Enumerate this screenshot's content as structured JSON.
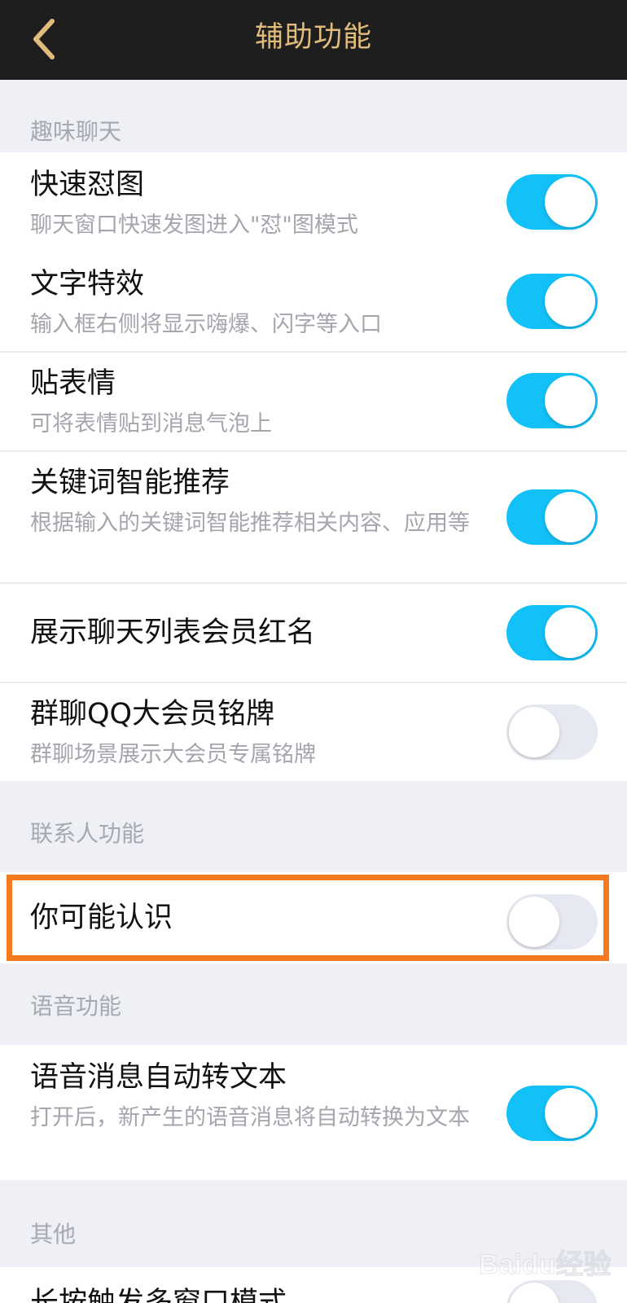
{
  "navbar": {
    "title": "辅助功能",
    "back_icon": "chevron-left-icon"
  },
  "colors": {
    "accent": "#12c1f8",
    "nav_bg": "#1f1e1f",
    "nav_title": "#e1bc7b",
    "highlight": "#f5791f"
  },
  "sections": {
    "fun_chat": {
      "header": "趣味聊天",
      "items": [
        {
          "title": "快速怼图",
          "subtitle": "聊天窗口快速发图进入\"怼\"图模式",
          "enabled": true
        },
        {
          "title": "文字特效",
          "subtitle": "输入框右侧将显示嗨爆、闪字等入口",
          "enabled": true
        },
        {
          "title": "贴表情",
          "subtitle": "可将表情贴到消息气泡上",
          "enabled": true
        },
        {
          "title": "关键词智能推荐",
          "subtitle": "根据输入的关键词智能推荐相关内容、应用等",
          "enabled": true
        },
        {
          "title": "展示聊天列表会员红名",
          "subtitle": "",
          "enabled": true
        },
        {
          "title": "群聊QQ大会员铭牌",
          "subtitle": "群聊场景展示大会员专属铭牌",
          "enabled": false
        }
      ]
    },
    "contacts": {
      "header": "联系人功能",
      "items": [
        {
          "title": "你可能认识",
          "subtitle": "",
          "enabled": false
        }
      ]
    },
    "voice": {
      "header": "语音功能",
      "items": [
        {
          "title": "语音消息自动转文本",
          "subtitle": "打开后，新产生的语音消息将自动转换为文本",
          "enabled": true
        }
      ]
    },
    "other": {
      "header": "其他",
      "items": [
        {
          "title": "长按触发多窗口模式",
          "subtitle": "",
          "enabled": false
        }
      ]
    }
  },
  "watermark": {
    "text": "Baidu经验"
  }
}
